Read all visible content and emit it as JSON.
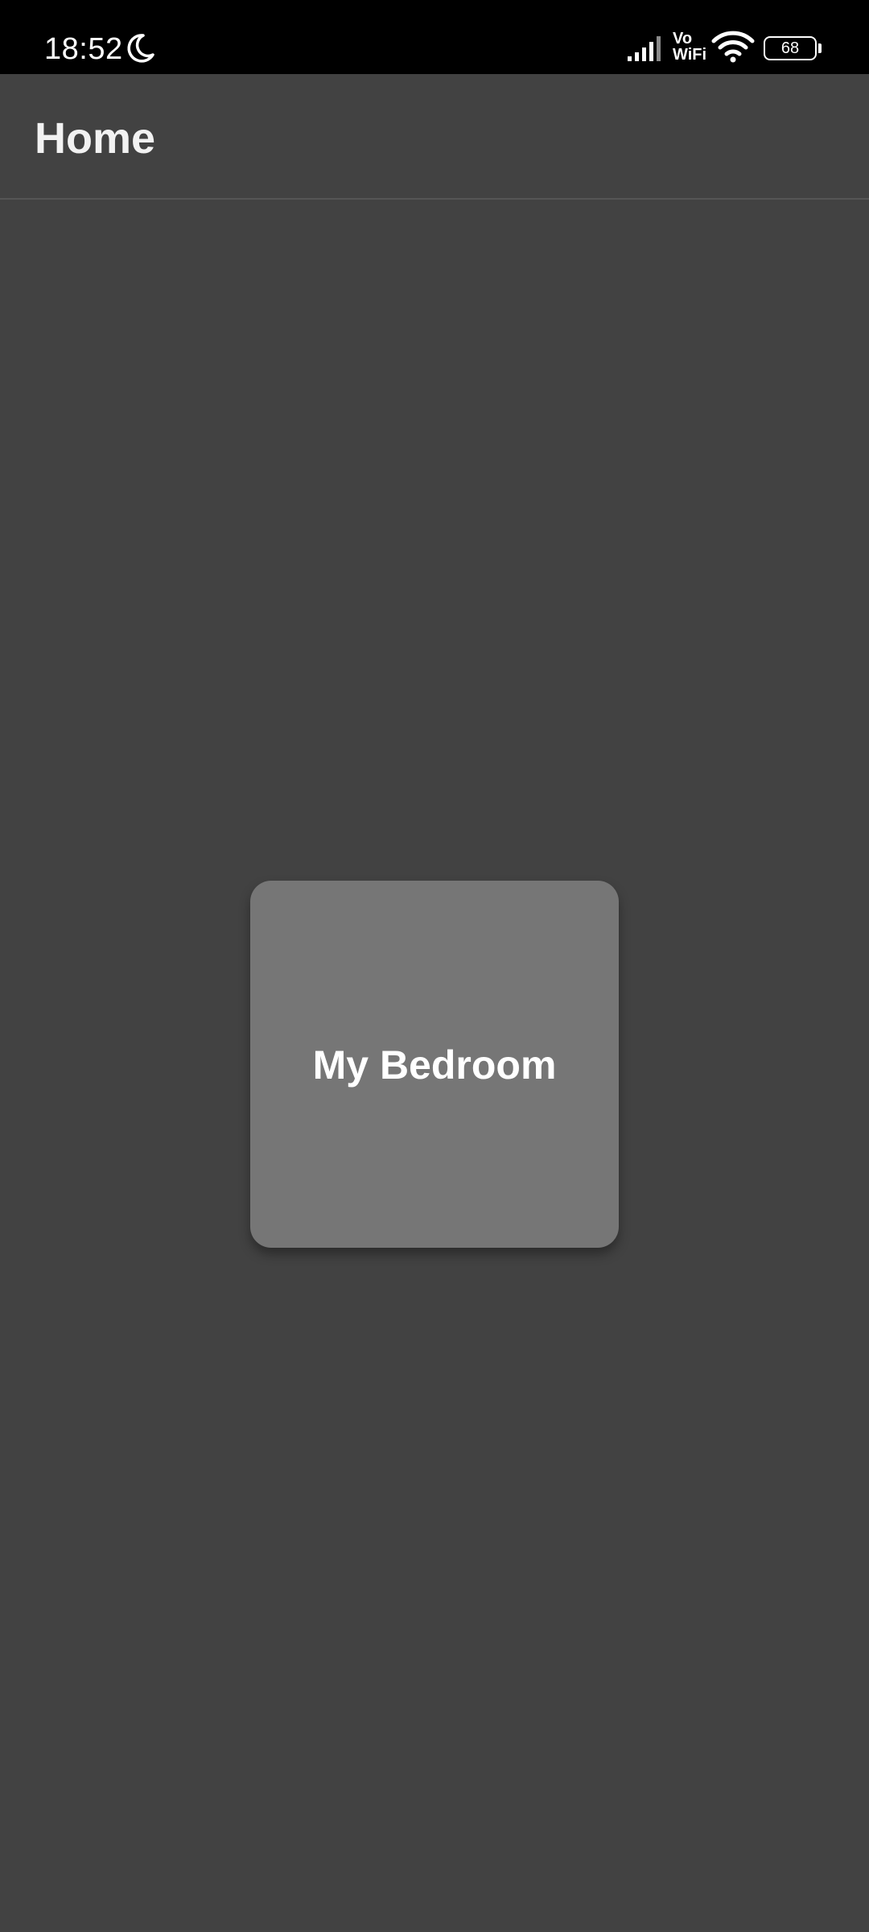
{
  "status_bar": {
    "time": "18:52",
    "vowifi_top": "Vo",
    "vowifi_bottom": "WiFi",
    "battery_level": "68",
    "icons": [
      "moon-icon",
      "signal-icon",
      "vowifi-icon",
      "wifi-icon",
      "battery-icon"
    ]
  },
  "app_bar": {
    "title": "Home"
  },
  "rooms": [
    {
      "name": "My Bedroom"
    }
  ],
  "colors": {
    "background": "#424242",
    "status_bar": "#000000",
    "card": "#767676",
    "text": "#ffffff"
  }
}
